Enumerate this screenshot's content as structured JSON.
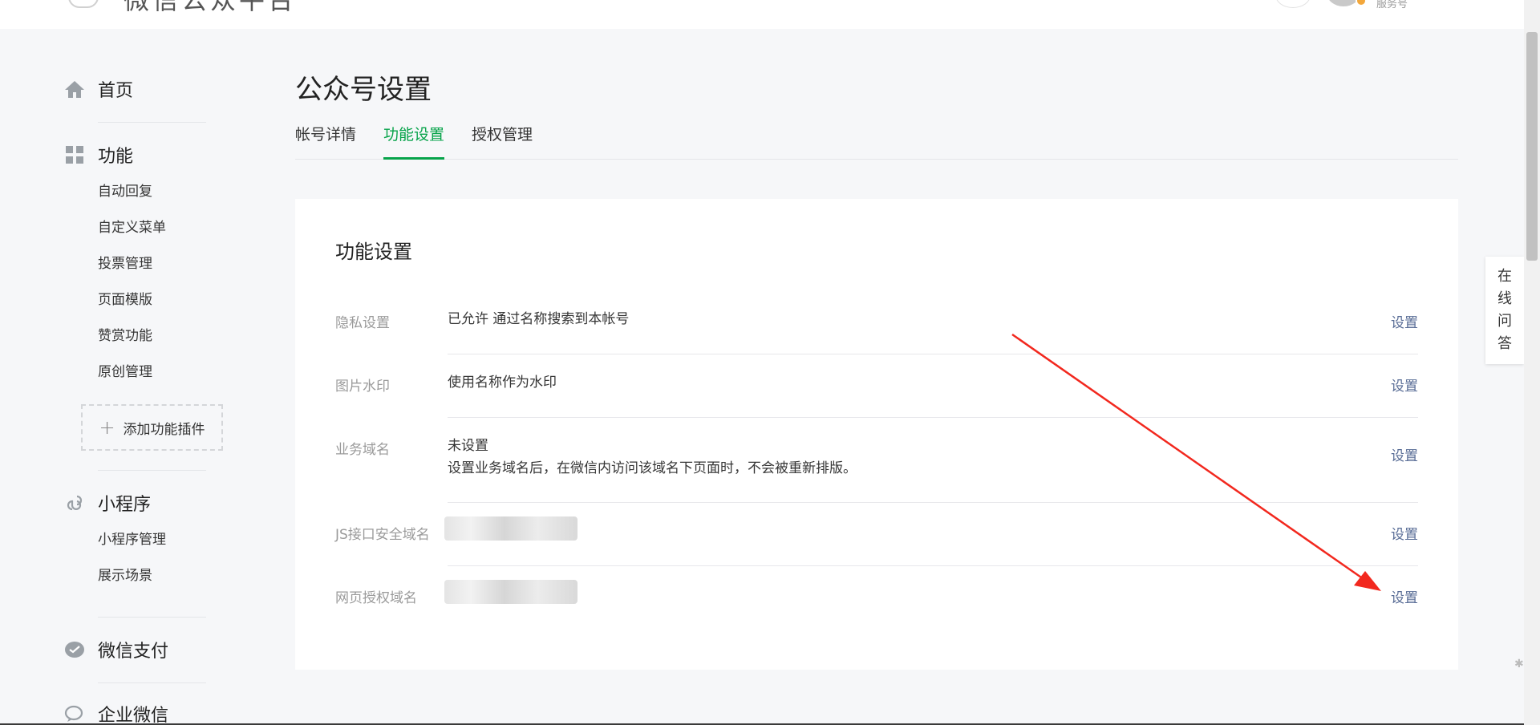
{
  "header": {
    "logo_text": "微信公众平台",
    "account_type": "服务号"
  },
  "sidebar": {
    "home": "首页",
    "features": {
      "title": "功能",
      "items": [
        "自动回复",
        "自定义菜单",
        "投票管理",
        "页面模版",
        "赞赏功能",
        "原创管理"
      ],
      "add_plugin": "添加功能插件"
    },
    "miniprogram": {
      "title": "小程序",
      "items": [
        "小程序管理",
        "展示场景"
      ]
    },
    "wechat_pay": "微信支付",
    "enterprise_wechat": "企业微信"
  },
  "main": {
    "page_title": "公众号设置",
    "tabs": [
      "帐号详情",
      "功能设置",
      "授权管理"
    ],
    "active_tab": "功能设置",
    "card_title": "功能设置",
    "rows": [
      {
        "label": "隐私设置",
        "value": "已允许 通过名称搜索到本帐号",
        "action": "设置"
      },
      {
        "label": "图片水印",
        "value": "使用名称作为水印",
        "action": "设置"
      },
      {
        "label": "业务域名",
        "value": "未设置",
        "note": "设置业务域名后，在微信内访问该域名下页面时，不会被重新排版。",
        "action": "设置"
      },
      {
        "label": "JS接口安全域名",
        "value": "",
        "action": "设置"
      },
      {
        "label": "网页授权域名",
        "value": "",
        "action": "设置"
      }
    ]
  },
  "help_widget": [
    "在",
    "线",
    "问",
    "答"
  ],
  "colors": {
    "accent_green": "#07a34a",
    "link_blue": "#576b95",
    "annotation_red": "#f2281e"
  }
}
